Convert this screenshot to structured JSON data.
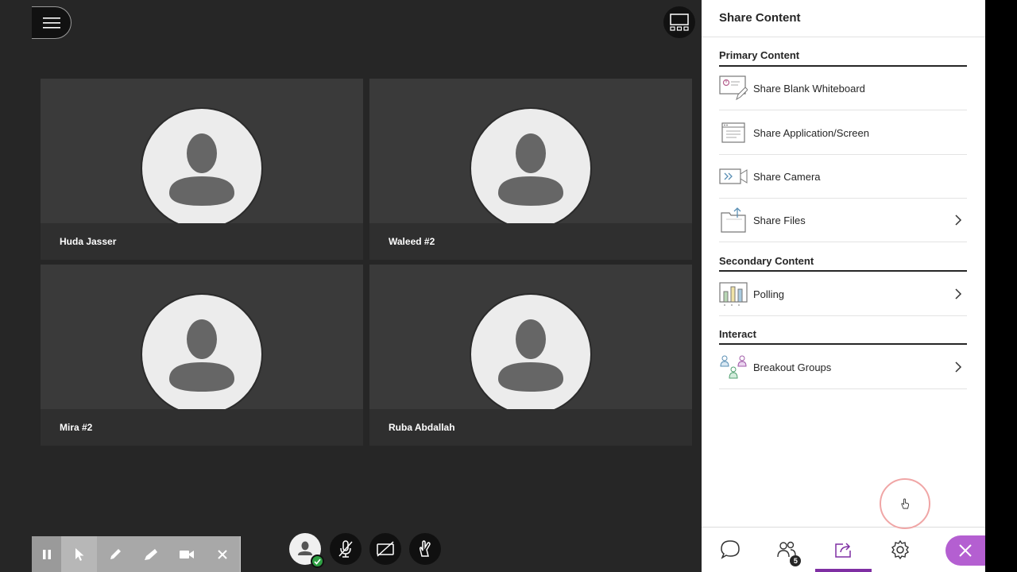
{
  "panel": {
    "title": "Share Content",
    "sections": [
      {
        "label": "Primary Content"
      },
      {
        "label": "Secondary Content"
      },
      {
        "label": "Interact"
      }
    ],
    "items": [
      {
        "label": "Share Blank Whiteboard",
        "icon": "whiteboard-icon"
      },
      {
        "label": "Share Application/Screen",
        "icon": "application-screen-icon"
      },
      {
        "label": "Share Camera",
        "icon": "camera-share-icon"
      },
      {
        "label": "Share Files",
        "icon": "files-icon"
      },
      {
        "label": "Polling",
        "icon": "polling-icon"
      },
      {
        "label": "Breakout Groups",
        "icon": "breakout-groups-icon"
      }
    ]
  },
  "participants": [
    {
      "name": "Huda Jasser"
    },
    {
      "name": "Waleed #2"
    },
    {
      "name": "Mira #2"
    },
    {
      "name": "Ruba Abdallah"
    }
  ],
  "tabs": {
    "attendees_count": "5"
  },
  "colors": {
    "accent": "#7f2fa3",
    "close_button": "#b45fd1",
    "stage_background": "#262626",
    "tile_background": "#3a3a3a"
  }
}
